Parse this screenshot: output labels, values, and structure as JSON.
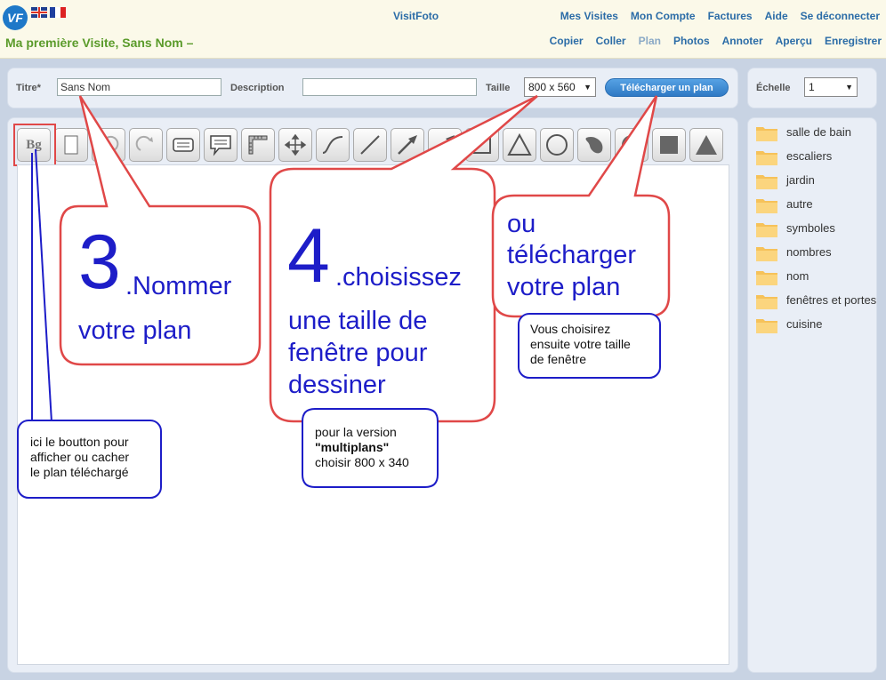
{
  "header": {
    "brand": "VisitFoto",
    "logo_text": "VF",
    "page_title": "Ma première Visite, Sans Nom –",
    "nav_top": [
      "Mes Visites",
      "Mon Compte",
      "Factures",
      "Aide",
      "Se déconnecter"
    ],
    "nav_bottom": [
      "Copier",
      "Coller",
      "Plan",
      "Photos",
      "Annoter",
      "Aperçu",
      "Enregistrer"
    ],
    "active_nav": "Plan"
  },
  "form": {
    "title_label": "Titre*",
    "title_value": "Sans Nom",
    "description_label": "Description",
    "description_value": "",
    "size_label": "Taille",
    "size_value": "800 x 560",
    "upload_button": "Télécharger un plan",
    "scale_label": "Échelle",
    "scale_value": "1"
  },
  "toolbar": {
    "bg_button": "Bg",
    "tools": [
      "background",
      "page",
      "undo",
      "redo",
      "text-box",
      "speech-bubble",
      "ruler",
      "move",
      "curve",
      "line",
      "arrow",
      "double-arrow",
      "rectangle-outline",
      "triangle-outline",
      "circle-outline",
      "blob",
      "circle-filled",
      "square-filled",
      "triangle-filled"
    ]
  },
  "sidebar": {
    "folders": [
      "salle de bain",
      "escaliers",
      "jardin",
      "autre",
      "symboles",
      "nombres",
      "nom",
      "fenêtres et portes",
      "cuisine"
    ]
  },
  "annotations": {
    "step3_num": "3",
    "step3_a": ".Nommer",
    "step3_b": "votre plan",
    "step4_num": "4",
    "step4_a": ".choisissez",
    "step4_b": "une taille de",
    "step4_c": "fenêtre pour",
    "step4_d": "dessiner",
    "upload_a": "ou",
    "upload_b": "télécharger",
    "upload_c": "votre plan",
    "note_size_1": "Vous choisirez",
    "note_size_2": "ensuite votre taille",
    "note_size_3": "de fenêtre",
    "note_multi_1": "pour la version",
    "note_multi_2": "\"multiplans\"",
    "note_multi_3": "choisir 800 x 340",
    "note_bg_1": "ici le boutton pour",
    "note_bg_2": "afficher ou cacher",
    "note_bg_3": "le plan téléchargé"
  },
  "colors": {
    "accent_blue": "#2b6ca7",
    "title_green": "#5b9b2b",
    "callout_red": "#e04848",
    "callout_text_blue": "#1d1dc8",
    "note_border_blue": "#1d1dc8"
  }
}
